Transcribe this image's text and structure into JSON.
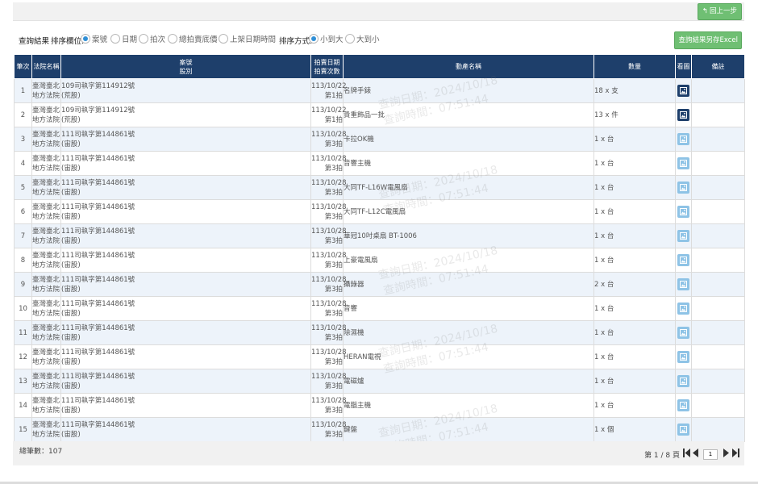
{
  "toolbar": {
    "back_label": "回上一步"
  },
  "sortbar": {
    "title": "查詢結果",
    "sort_field_label": "排序欄位:",
    "sort_fields": [
      {
        "label": "案號",
        "selected": true
      },
      {
        "label": "日期",
        "selected": false
      },
      {
        "label": "拍次",
        "selected": false
      },
      {
        "label": "總拍賣底價",
        "selected": false
      },
      {
        "label": "上架日期時間",
        "selected": false
      }
    ],
    "sort_order_label": "排序方式:",
    "sort_orders": [
      {
        "label": "小到大",
        "selected": true
      },
      {
        "label": "大到小",
        "selected": false
      }
    ],
    "export_label": "查詢結果另存Excel"
  },
  "table": {
    "headers": {
      "index": "筆次",
      "court": "法院名稱",
      "case_line1": "案號",
      "case_line2": "股別",
      "date_line1": "拍賣日期",
      "date_line2": "拍賣次數",
      "item": "動產名稱",
      "qty": "數量",
      "image": "看圖",
      "note": "備註"
    },
    "rows": [
      {
        "idx": "1",
        "court1": "臺灣臺北",
        "court2": "地方法院",
        "case1": "109司執字第114912號",
        "case2": "(荒股)",
        "date1": "113/10/22",
        "date2": "第1拍",
        "item": "名牌手錶",
        "qty": "18 x 支",
        "img": "dark",
        "note": ""
      },
      {
        "idx": "2",
        "court1": "臺灣臺北",
        "court2": "地方法院",
        "case1": "109司執字第114912號",
        "case2": "(荒股)",
        "date1": "113/10/22",
        "date2": "第1拍",
        "item": "貴重飾品一批",
        "qty": "13 x 件",
        "img": "dark",
        "note": ""
      },
      {
        "idx": "3",
        "court1": "臺灣臺北",
        "court2": "地方法院",
        "case1": "111司執字第144861號",
        "case2": "(宙股)",
        "date1": "113/10/28",
        "date2": "第3拍",
        "item": "卡拉OK機",
        "qty": "1 x 台",
        "img": "light",
        "note": ""
      },
      {
        "idx": "4",
        "court1": "臺灣臺北",
        "court2": "地方法院",
        "case1": "111司執字第144861號",
        "case2": "(宙股)",
        "date1": "113/10/28",
        "date2": "第3拍",
        "item": "音響主機",
        "qty": "1 x 台",
        "img": "light",
        "note": ""
      },
      {
        "idx": "5",
        "court1": "臺灣臺北",
        "court2": "地方法院",
        "case1": "111司執字第144861號",
        "case2": "(宙股)",
        "date1": "113/10/28",
        "date2": "第3拍",
        "item": "大同TF-L16W電風扇",
        "qty": "1 x 台",
        "img": "light",
        "note": ""
      },
      {
        "idx": "6",
        "court1": "臺灣臺北",
        "court2": "地方法院",
        "case1": "111司執字第144861號",
        "case2": "(宙股)",
        "date1": "113/10/28",
        "date2": "第3拍",
        "item": "大同TF-L12C電風扇",
        "qty": "1 x 台",
        "img": "light",
        "note": ""
      },
      {
        "idx": "7",
        "court1": "臺灣臺北",
        "court2": "地方法院",
        "case1": "111司執字第144861號",
        "case2": "(宙股)",
        "date1": "113/10/28",
        "date2": "第3拍",
        "item": "華冠10吋桌扇 BT-1006",
        "qty": "1 x 台",
        "img": "light",
        "note": ""
      },
      {
        "idx": "8",
        "court1": "臺灣臺北",
        "court2": "地方法院",
        "case1": "111司執字第144861號",
        "case2": "(宙股)",
        "date1": "113/10/28",
        "date2": "第3拍",
        "item": "上豪電風扇",
        "qty": "1 x 台",
        "img": "light",
        "note": ""
      },
      {
        "idx": "9",
        "court1": "臺灣臺北",
        "court2": "地方法院",
        "case1": "111司執字第144861號",
        "case2": "(宙股)",
        "date1": "113/10/28",
        "date2": "第3拍",
        "item": "攝錄器",
        "qty": "2 x 台",
        "img": "light",
        "note": ""
      },
      {
        "idx": "10",
        "court1": "臺灣臺北",
        "court2": "地方法院",
        "case1": "111司執字第144861號",
        "case2": "(宙股)",
        "date1": "113/10/28",
        "date2": "第3拍",
        "item": "音響",
        "qty": "1 x 台",
        "img": "light",
        "note": ""
      },
      {
        "idx": "11",
        "court1": "臺灣臺北",
        "court2": "地方法院",
        "case1": "111司執字第144861號",
        "case2": "(宙股)",
        "date1": "113/10/28",
        "date2": "第3拍",
        "item": "除濕機",
        "qty": "1 x 台",
        "img": "light",
        "note": ""
      },
      {
        "idx": "12",
        "court1": "臺灣臺北",
        "court2": "地方法院",
        "case1": "111司執字第144861號",
        "case2": "(宙股)",
        "date1": "113/10/28",
        "date2": "第3拍",
        "item": "HERAN電視",
        "qty": "1 x 台",
        "img": "light",
        "note": ""
      },
      {
        "idx": "13",
        "court1": "臺灣臺北",
        "court2": "地方法院",
        "case1": "111司執字第144861號",
        "case2": "(宙股)",
        "date1": "113/10/28",
        "date2": "第3拍",
        "item": "電磁爐",
        "qty": "1 x 台",
        "img": "light",
        "note": ""
      },
      {
        "idx": "14",
        "court1": "臺灣臺北",
        "court2": "地方法院",
        "case1": "111司執字第144861號",
        "case2": "(宙股)",
        "date1": "113/10/28",
        "date2": "第3拍",
        "item": "電腦主機",
        "qty": "1 x 台",
        "img": "light",
        "note": ""
      },
      {
        "idx": "15",
        "court1": "臺灣臺北",
        "court2": "地方法院",
        "case1": "111司執字第144861號",
        "case2": "(宙股)",
        "date1": "113/10/28",
        "date2": "第3拍",
        "item": "鍵盤",
        "qty": "1 x 個",
        "img": "light",
        "note": ""
      }
    ]
  },
  "footer": {
    "total_label": "總筆數：107",
    "page_label": "第 1 / 8 頁",
    "page_input": "1"
  },
  "watermark": {
    "date_line": "查詢日期：2024/10/18",
    "time_line": "查詢時間：07:51:44"
  },
  "colors": {
    "header_bg": "#1e3f6b",
    "button_green": "#6fbf73",
    "row_alt": "#edf3fa",
    "link_blue": "#4a7fb5",
    "radio_selected": "#2f8fd6"
  },
  "icons": {
    "back": "reply-arrow-icon",
    "image": "picture-icon",
    "first": "first-page-icon",
    "prev": "prev-page-icon",
    "next": "next-page-icon",
    "last": "last-page-icon"
  }
}
